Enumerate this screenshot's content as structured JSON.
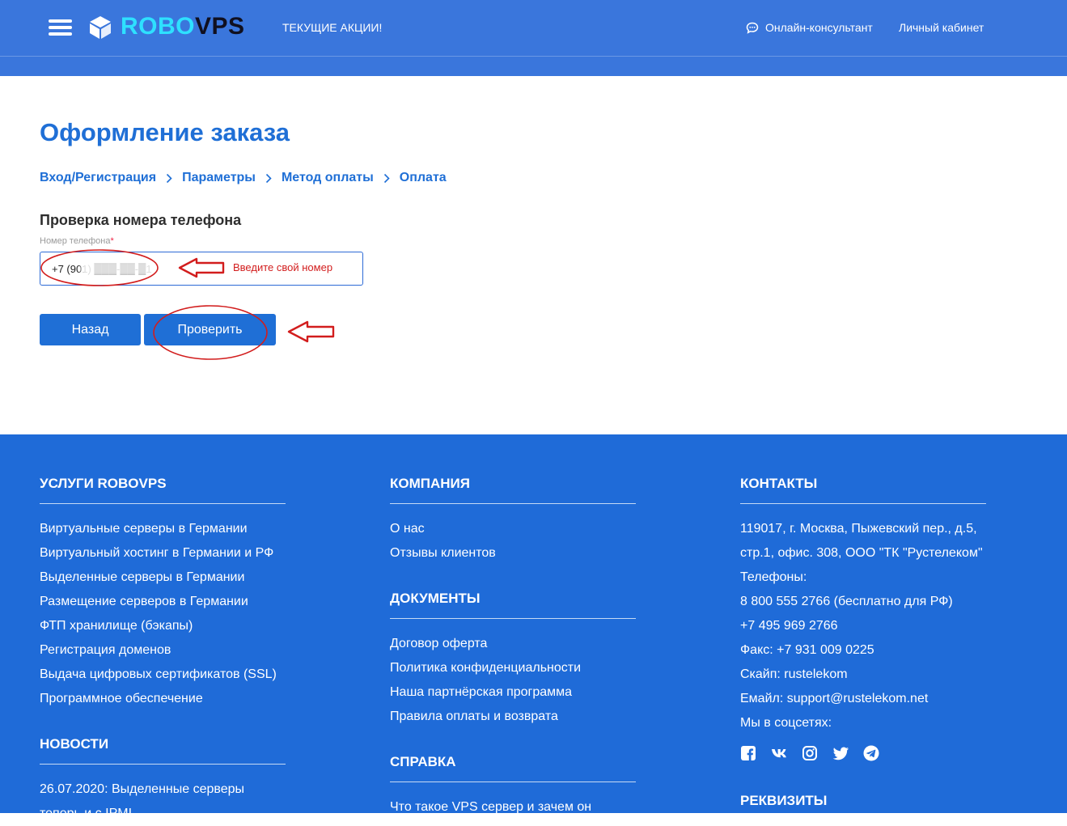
{
  "header": {
    "logo_part1": "ROBO",
    "logo_part2": "VPS",
    "promo_link": "ТЕКУЩИЕ АКЦИИ!",
    "consultant_link": "Онлайн-консультант",
    "cabinet_link": "Личный кабинет",
    "colors": {
      "bar": "#3a76dc",
      "logo_robo": "#2ee0ff",
      "logo_vps": "#101020"
    }
  },
  "main": {
    "title": "Оформление заказа",
    "breadcrumb": [
      "Вход/Регистрация",
      "Параметры",
      "Метод оплаты",
      "Оплата"
    ],
    "breadcrumb_separator": "›",
    "section_title": "Проверка номера телефона",
    "phone_label": "Номер телефона",
    "phone_required_mark": "*",
    "phone_value": "+7 (901) ███-██-█1",
    "hint_text": "Введите свой номер",
    "back_button": "Назад",
    "check_button": "Проверить",
    "colors": {
      "accent": "#1f6fd6",
      "annotation": "#d21d1d"
    }
  },
  "footer": {
    "services": {
      "heading": "УСЛУГИ ROBOVPS",
      "items": [
        "Виртуальные серверы в Германии",
        "Виртуальный хостинг в Германии и РФ",
        "Выделенные серверы в Германии",
        "Размещение серверов в Германии",
        "ФТП хранилище (бэкапы)",
        "Регистрация доменов",
        "Выдача цифровых сертификатов (SSL)",
        "Программное обеспечение"
      ]
    },
    "news": {
      "heading": "НОВОСТИ",
      "items": [
        "26.07.2020: Выделенные серверы",
        "теперь и с IPMI"
      ]
    },
    "company": {
      "heading": "КОМПАНИЯ",
      "items": [
        "О нас",
        "Отзывы клиентов"
      ]
    },
    "documents": {
      "heading": "ДОКУМЕНТЫ",
      "items": [
        "Договор оферта",
        "Политика конфиденциальности",
        "Наша партнёрская программа",
        "Правила оплаты и возврата"
      ]
    },
    "help": {
      "heading": "СПРАВКА",
      "items": [
        "Что такое VPS сервер и зачем он"
      ]
    },
    "contacts": {
      "heading": "КОНТАКТЫ",
      "lines": [
        "119017, г. Москва, Пыжевский пер., д.5,",
        "стр.1, офис. 308, ООО \"ТК \"Рустелеком\"",
        "Телефоны:",
        "8 800 555 2766 (бесплатно для РФ)",
        "+7 495 969 2766",
        "Факс: +7 931 009 0225",
        "Скайп: rustelekom",
        "Емайл: support@rustelekom.net",
        "Мы в соцсетях:"
      ],
      "social_icons": [
        "facebook-icon",
        "vk-icon",
        "instagram-icon",
        "twitter-icon",
        "telegram-icon"
      ]
    },
    "requisites": {
      "heading": "РЕКВИЗИТЫ"
    },
    "colors": {
      "background": "#1f6bd8"
    }
  }
}
